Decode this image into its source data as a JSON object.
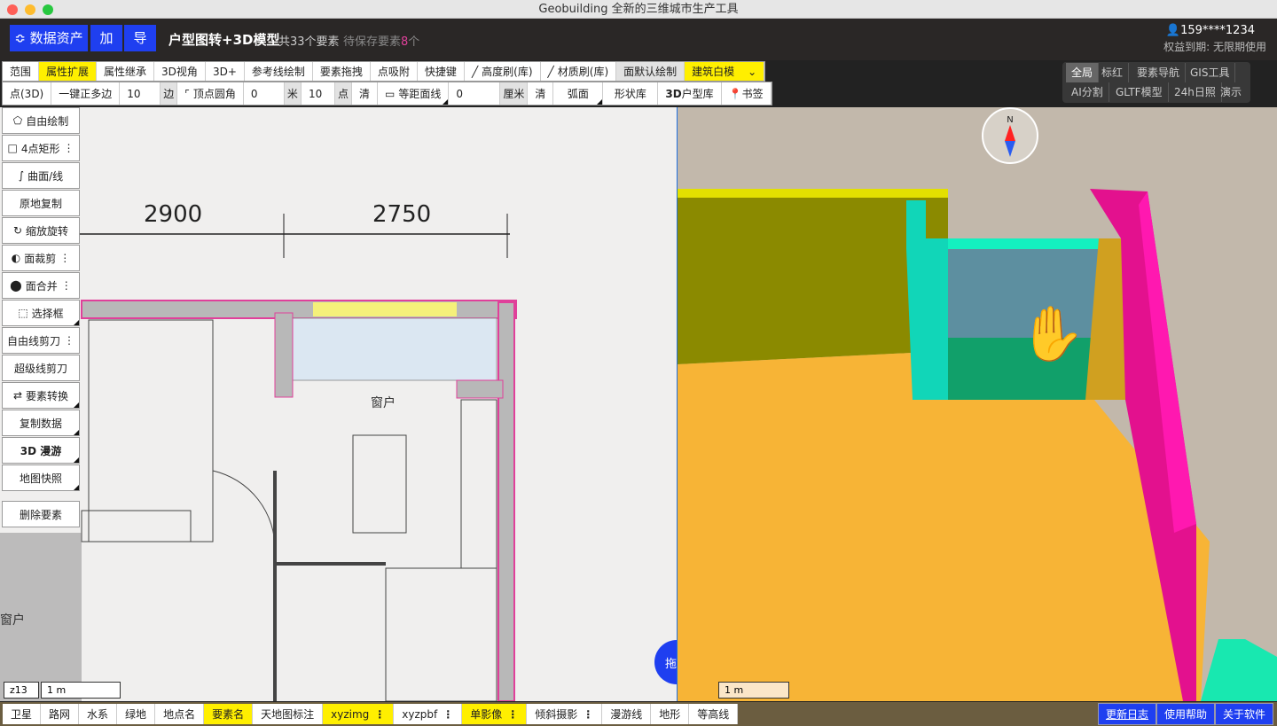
{
  "window": {
    "title": "Geobuilding 全新的三维城市生产工具"
  },
  "header": {
    "assets_btn": "数据资产",
    "add_btn": "加",
    "export_btn": "导",
    "project_title": "户型图转+3D模型",
    "element_count": "共33个要素",
    "pending_prefix": "待保存要素",
    "pending_count": "8",
    "pending_suffix": "个",
    "user": "159****1234",
    "rights": "权益到期: 无限期使用",
    "accent": "#1f3ff0"
  },
  "toolbar1": [
    "范围",
    "属性扩展",
    "属性继承",
    "3D视角",
    "3D+",
    "参考线绘制",
    "要素拖拽",
    "点吸附",
    "快捷键",
    "高度刷(库)",
    "材质刷(库)",
    "面默认绘制"
  ],
  "toolbar1_select": "建筑白模",
  "toolbar2": {
    "point3d": "点(3D)",
    "regular_polygon": "一键正多边",
    "sides_value": "10",
    "sides_unit": "边",
    "vertex_round": "顶点圆角",
    "radius_value": "0",
    "radius_unit": "米",
    "points_value": "10",
    "points_unit": "点",
    "clear1": "清",
    "offset_line": "等距面线",
    "offset_value": "0",
    "offset_unit": "厘米",
    "clear2": "清",
    "arc": "弧面",
    "shape_lib": "形状库",
    "house_lib_bold": "3D",
    "house_lib": "户型库",
    "bookmark": "书签"
  },
  "right_tabs": [
    "全局",
    "标红",
    "要素导航",
    "GIS工具",
    "AI分割",
    "GLTF模型",
    "24h日照",
    "演示"
  ],
  "sidebar": [
    "自由绘制",
    "4点矩形",
    "曲面/线",
    "原地复制",
    "缩放旋转",
    "面裁剪",
    "面合并",
    "选择框",
    "自由线剪刀",
    "超级线剪刀",
    "要素转换",
    "复制数据",
    "3D 漫游",
    "地图快照",
    "删除要素"
  ],
  "plan": {
    "dim1": "2900",
    "dim2": "2750",
    "window_label": "窗户",
    "side_label": "窗户"
  },
  "zoom_level": "z13",
  "scale_2d": "1 m",
  "scale_3d": "1 m",
  "drag_btn": "拖拽",
  "compass": "N",
  "bottom_layers": [
    "卫星",
    "路网",
    "水系",
    "绿地",
    "地点名",
    "要素名",
    "天地图标注",
    "xyzimg",
    "xyzpbf",
    "单影像",
    "倾斜摄影",
    "漫游线",
    "地形",
    "等高线"
  ],
  "bottom_links": [
    "更新日志",
    "使用帮助",
    "关于软件"
  ]
}
